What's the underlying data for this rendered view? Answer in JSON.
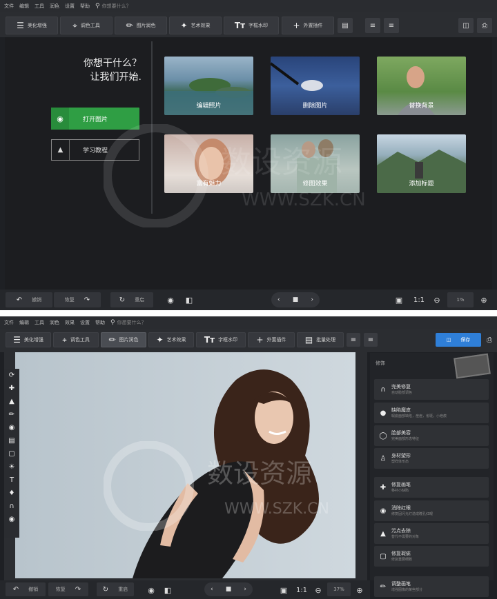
{
  "menu": [
    "文件",
    "编辑",
    "工具",
    "润色",
    "设置",
    "帮助"
  ],
  "menu2": [
    "文件",
    "编辑",
    "工具",
    "润色",
    "效果",
    "设置",
    "帮助"
  ],
  "search_placeholder": "你想要什么？",
  "tools1": [
    {
      "label": "美化增强",
      "icon": "sliders-icon"
    },
    {
      "label": "调色工具",
      "icon": "crop-icon"
    },
    {
      "label": "图片润色",
      "icon": "brush-icon"
    },
    {
      "label": "艺术效果",
      "icon": "magic-wand-icon"
    },
    {
      "label": "字框水印",
      "icon": "text-icon"
    },
    {
      "label": "外置插件",
      "icon": "plus-icon"
    }
  ],
  "tools2": [
    {
      "label": "美化增强",
      "icon": "sliders-icon"
    },
    {
      "label": "调色工具",
      "icon": "crop-icon"
    },
    {
      "label": "图片润色",
      "icon": "brush-icon"
    },
    {
      "label": "艺术效果",
      "icon": "magic-wand-icon"
    },
    {
      "label": "字框水印",
      "icon": "text-icon"
    },
    {
      "label": "外置插件",
      "icon": "plus-icon"
    },
    {
      "label": "批量处理",
      "icon": "batch-icon"
    }
  ],
  "welcome": {
    "line1": "你想干什么？",
    "line2": "让我们开始."
  },
  "open_label": "打开图片",
  "learn_label": "学习教程",
  "cards": [
    {
      "label": "编辑照片"
    },
    {
      "label": "删除图片"
    },
    {
      "label": "替换背景"
    },
    {
      "label": "富有魅力"
    },
    {
      "label": "修图效果"
    },
    {
      "label": "添加标题"
    }
  ],
  "bottom": {
    "undo": "撤销",
    "redo": "恢复",
    "reset": "重启",
    "ratio": "1:1",
    "zoom1": "1%",
    "zoom2": "37%"
  },
  "save_label": "保存",
  "panel": {
    "title": "修饰",
    "items": [
      {
        "title": "完美修复",
        "sub": "自动脸部调色"
      },
      {
        "title": "缺陷魔皮",
        "sub": "瑕疵面部缺陷，痘痘，雀斑，小疤痕"
      },
      {
        "title": "脸部美容",
        "sub": "完美面部形态特征"
      },
      {
        "title": "身材塑形",
        "sub": "塑样体形态"
      },
      {
        "title": "修复画笔",
        "sub": "移补小缺陷"
      },
      {
        "title": "消除红眼",
        "sub": "修复因闪光灯造成瞳孔红眼"
      },
      {
        "title": "污点去除",
        "sub": "替代不需要的对象"
      },
      {
        "title": "修复瑕疵",
        "sub": "修复重要细致"
      },
      {
        "title": "调整画笔",
        "sub": "增强图像的某些部分"
      }
    ]
  }
}
